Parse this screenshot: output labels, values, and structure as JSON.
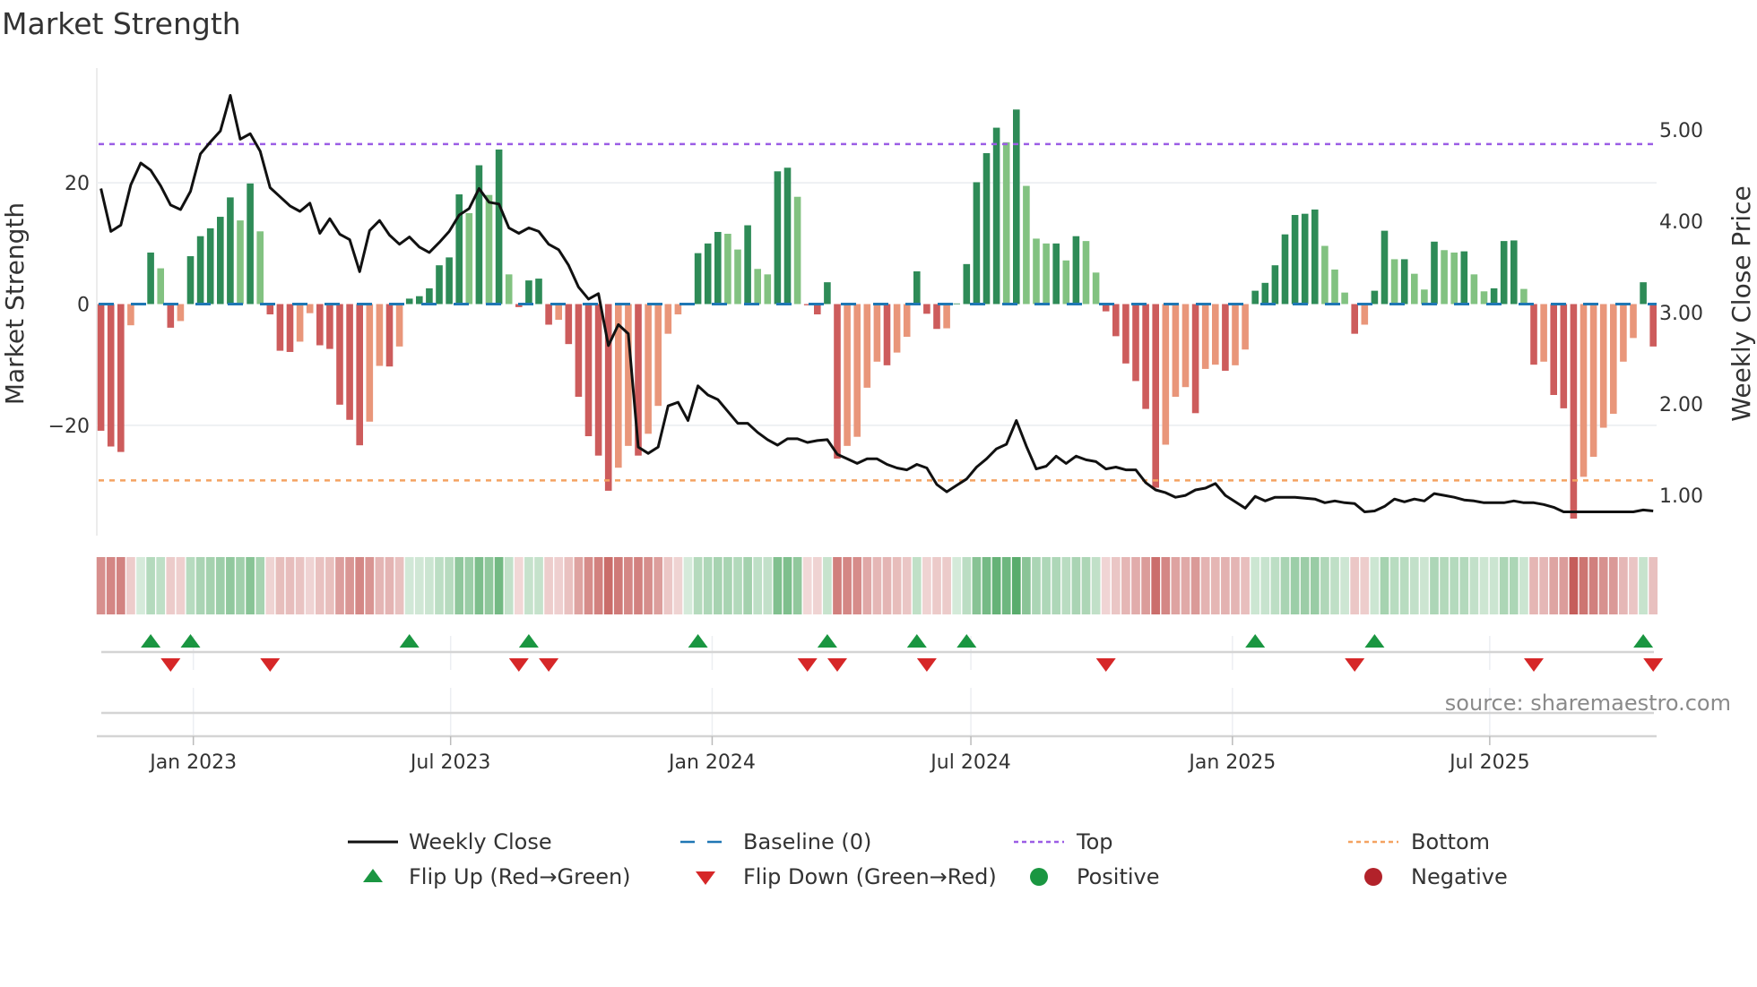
{
  "chart_data": {
    "type": "bar",
    "title": "Market Strength",
    "ylabel": "Market Strength",
    "y2label": "Weekly Close Price",
    "source": "source: sharemaestro.com",
    "interval": "weekly",
    "start_date": "2022-10-28",
    "ylim": [
      -38.2,
      38.2
    ],
    "y2lim": [
      0.56,
      5.63
    ],
    "yticks": [
      {
        "value": 20,
        "label": "20"
      },
      {
        "value": 0,
        "label": "0"
      },
      {
        "value": -20,
        "label": "−20"
      }
    ],
    "y2ticks": [
      {
        "value": 5,
        "label": "5.00"
      },
      {
        "value": 4,
        "label": "4.00"
      },
      {
        "value": 3,
        "label": "3.00"
      },
      {
        "value": 2,
        "label": "2.00"
      },
      {
        "value": 1,
        "label": "1.00"
      }
    ],
    "xticks": [
      {
        "date": "2023-01-01",
        "label": "Jan 2023"
      },
      {
        "date": "2023-07-01",
        "label": "Jul 2023"
      },
      {
        "date": "2024-01-01",
        "label": "Jan 2024"
      },
      {
        "date": "2024-07-01",
        "label": "Jul 2024"
      },
      {
        "date": "2025-01-01",
        "label": "Jan 2025"
      },
      {
        "date": "2025-07-01",
        "label": "Jul 2025"
      }
    ],
    "top_threshold": 26.4,
    "bottom_threshold": -29.1,
    "grid": true,
    "strength": [
      -20.9,
      -23.5,
      -24.4,
      -3.5,
      0,
      8.5,
      5.9,
      -3.9,
      -2.8,
      7.9,
      11.2,
      12.5,
      14.4,
      17.6,
      13.8,
      19.9,
      12.0,
      -1.7,
      -7.7,
      -7.9,
      -6.2,
      -1.5,
      -6.8,
      -7.4,
      -16.6,
      -19.1,
      -23.3,
      -19.4,
      -10.2,
      -10.3,
      -7.0,
      0.9,
      1.3,
      2.6,
      6.4,
      7.7,
      18.1,
      15.0,
      22.9,
      18.0,
      25.5,
      4.9,
      -0.5,
      3.9,
      4.2,
      -3.4,
      -2.6,
      -6.6,
      -15.3,
      -21.8,
      -25.0,
      -30.8,
      -27.0,
      -23.4,
      -25.0,
      -21.4,
      -16.8,
      -4.9,
      -1.7,
      0,
      8.4,
      10.0,
      11.9,
      11.6,
      9.0,
      13.0,
      5.8,
      4.9,
      21.9,
      22.5,
      17.7,
      -0.2,
      -1.7,
      3.6,
      -25.5,
      -23.4,
      -21.9,
      -13.8,
      -9.5,
      -10.1,
      -8.0,
      -5.4,
      5.4,
      -1.6,
      -4.1,
      -4.0,
      0.1,
      6.6,
      20.1,
      24.9,
      29.1,
      26.7,
      32.1,
      19.5,
      10.8,
      10.0,
      10.0,
      7.2,
      11.2,
      10.4,
      5.2,
      -1.2,
      -5.3,
      -9.8,
      -12.7,
      -17.3,
      -30.3,
      -23.2,
      -15.3,
      -13.7,
      -18.0,
      -10.7,
      -10.0,
      -11.0,
      -10.1,
      -7.5,
      2.2,
      3.5,
      6.4,
      11.5,
      14.7,
      14.9,
      15.6,
      9.6,
      5.7,
      1.9,
      -4.9,
      -3.4,
      2.2,
      12.1,
      7.4,
      7.4,
      5.0,
      2.4,
      10.3,
      8.9,
      8.5,
      8.7,
      4.9,
      2.1,
      2.6,
      10.4,
      10.5,
      2.5,
      -10.0,
      -9.5,
      -15.0,
      -17.2,
      -35.4,
      -28.5,
      -25.2,
      -20.4,
      -18.1,
      -9.5,
      -5.6,
      3.6,
      -7.0
    ],
    "weekly_close": [
      4.36,
      3.89,
      3.96,
      4.4,
      4.64,
      4.56,
      4.39,
      4.18,
      4.13,
      4.33,
      4.74,
      4.87,
      4.99,
      5.38,
      4.9,
      4.96,
      4.77,
      4.37,
      4.27,
      4.17,
      4.11,
      4.2,
      3.87,
      4.03,
      3.86,
      3.8,
      3.45,
      3.9,
      4.01,
      3.85,
      3.75,
      3.83,
      3.72,
      3.66,
      3.77,
      3.89,
      4.07,
      4.14,
      4.36,
      4.21,
      4.19,
      3.93,
      3.87,
      3.93,
      3.89,
      3.75,
      3.69,
      3.52,
      3.28,
      3.15,
      3.21,
      2.64,
      2.87,
      2.77,
      1.53,
      1.46,
      1.53,
      1.98,
      2.02,
      1.82,
      2.2,
      2.1,
      2.05,
      1.92,
      1.79,
      1.79,
      1.69,
      1.61,
      1.55,
      1.62,
      1.62,
      1.58,
      1.6,
      1.61,
      1.45,
      1.4,
      1.35,
      1.4,
      1.4,
      1.34,
      1.3,
      1.28,
      1.34,
      1.3,
      1.12,
      1.04,
      1.11,
      1.18,
      1.31,
      1.4,
      1.51,
      1.56,
      1.82,
      1.54,
      1.29,
      1.32,
      1.43,
      1.35,
      1.43,
      1.39,
      1.37,
      1.29,
      1.31,
      1.28,
      1.28,
      1.14,
      1.06,
      1.03,
      0.98,
      1.0,
      1.06,
      1.08,
      1.13,
      1.0,
      0.93,
      0.86,
      0.99,
      0.94,
      0.98,
      0.98,
      0.98,
      0.97,
      0.96,
      0.92,
      0.94,
      0.92,
      0.91,
      0.82,
      0.83,
      0.88,
      0.96,
      0.93,
      0.96,
      0.94,
      1.02,
      1.0,
      0.98,
      0.95,
      0.94,
      0.92,
      0.92,
      0.92,
      0.94,
      0.92,
      0.92,
      0.9,
      0.87,
      0.82,
      0.82,
      0.82,
      0.82,
      0.82,
      0.82,
      0.82,
      0.82,
      0.84,
      0.83
    ],
    "flip_up_week_index": [
      5,
      9,
      31,
      43,
      60,
      73,
      82,
      87,
      116,
      128,
      155
    ],
    "flip_down_week_index": [
      7,
      17,
      42,
      45,
      71,
      74,
      83,
      101,
      126,
      144,
      156
    ],
    "legend": {
      "placement": "bottom",
      "items": [
        {
          "key": "close",
          "label": "Weekly Close"
        },
        {
          "key": "baseline",
          "label": "Baseline (0)"
        },
        {
          "key": "top",
          "label": "Top"
        },
        {
          "key": "bottom",
          "label": "Bottom"
        },
        {
          "key": "flip_up",
          "label": "Flip Up (Red→Green)"
        },
        {
          "key": "flip_down",
          "label": "Flip Down (Green→Red)"
        },
        {
          "key": "positive",
          "label": "Positive"
        },
        {
          "key": "negative",
          "label": "Negative"
        }
      ]
    },
    "colors": {
      "green_strong": "#2e8b57",
      "green_weak": "#82c281",
      "red_strong": "#cd5c5c",
      "red_weak": "#e9967a",
      "baseline": "#1f77b4",
      "top": "#9b5de5",
      "bottom": "#f4a261",
      "close": "#111111",
      "flip_up": "#1a9641",
      "flip_down": "#d62728",
      "positive": "#1a9641",
      "negative": "#b2222a"
    }
  }
}
